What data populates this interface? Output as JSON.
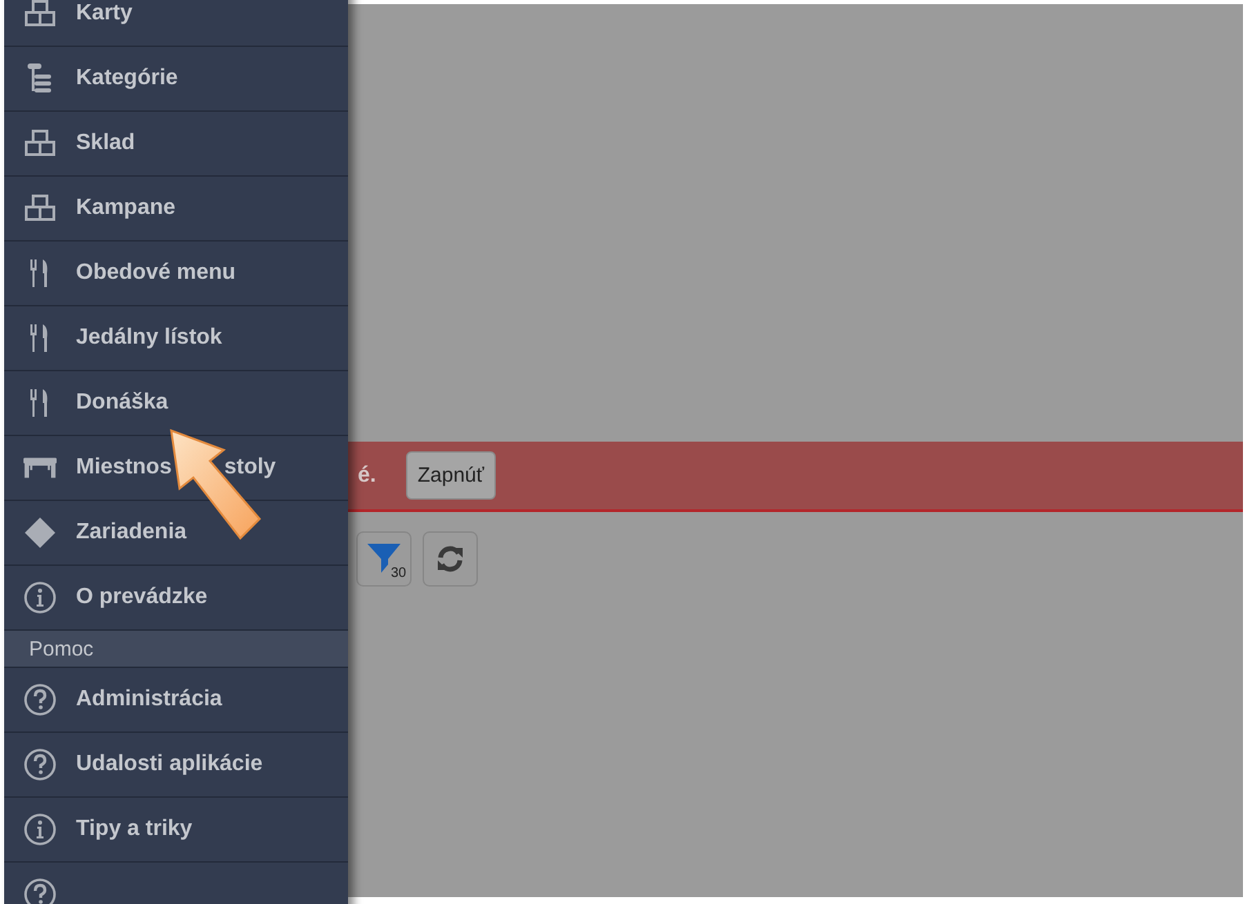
{
  "sidebar": {
    "items": [
      {
        "label": "Karty",
        "kind": "boxes"
      },
      {
        "label": "Kategórie",
        "kind": "tree"
      },
      {
        "label": "Sklad",
        "kind": "boxes"
      },
      {
        "label": "Kampane",
        "kind": "boxes"
      },
      {
        "label": "Obedové menu",
        "kind": "cutlery"
      },
      {
        "label": "Jedálny lístok",
        "kind": "cutlery"
      },
      {
        "label": "Donáška",
        "kind": "cutlery"
      },
      {
        "label": "Miestnos",
        "label_after_arrow": "stoly",
        "kind": "table"
      },
      {
        "label": "Zariadenia",
        "kind": "diamond"
      },
      {
        "label": "O prevádzke",
        "kind": "info"
      }
    ],
    "section": "Pomoc",
    "help_items": [
      {
        "label": "Administrácia",
        "kind": "help"
      },
      {
        "label": "Udalosti aplikácie",
        "kind": "help"
      },
      {
        "label": "Tipy a triky",
        "kind": "info"
      },
      {
        "kind": "help"
      }
    ]
  },
  "banner": {
    "text": "é.",
    "button": "Zapnúť"
  },
  "toolbar": {
    "filter_count": "30"
  }
}
